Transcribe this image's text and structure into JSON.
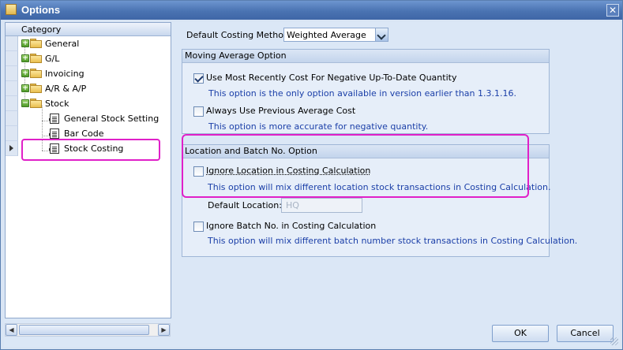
{
  "window": {
    "title": "Options",
    "close_glyph": "✕"
  },
  "category_panel": {
    "header": "Category",
    "items": [
      {
        "label": "General",
        "type": "folder",
        "expander": "+"
      },
      {
        "label": "G/L",
        "type": "folder",
        "expander": "+"
      },
      {
        "label": "Invoicing",
        "type": "folder",
        "expander": "+"
      },
      {
        "label": "A/R & A/P",
        "type": "folder",
        "expander": "+"
      },
      {
        "label": "Stock",
        "type": "folder",
        "expander": "−"
      },
      {
        "label": "General Stock Setting",
        "type": "page"
      },
      {
        "label": "Bar Code",
        "type": "page"
      },
      {
        "label": "Stock Costing",
        "type": "page",
        "selected": true
      }
    ],
    "scroll_left": "◀",
    "scroll_right": "▶"
  },
  "costing": {
    "label": "Default Costing Method:",
    "value": "Weighted Average"
  },
  "moving_average": {
    "title": "Moving Average Option",
    "options": [
      {
        "label": "Use Most Recently Cost For Negative Up-To-Date Quantity",
        "checked": true,
        "note": "This option is the only option available in version earlier than 1.3.1.16."
      },
      {
        "label": "Always Use Previous Average Cost",
        "checked": false,
        "note": "This option is more accurate for negative quantity."
      }
    ]
  },
  "location_batch": {
    "title": "Location and Batch No. Option",
    "ignore_location": {
      "label": "Ignore Location in Costing Calculation",
      "checked": false,
      "note": "This option will mix different location stock transactions in Costing Calculation."
    },
    "default_location": {
      "label": "Default Location:",
      "value": "HQ"
    },
    "ignore_batch": {
      "label": "Ignore Batch No. in Costing Calculation",
      "checked": false,
      "note": "This option will mix different batch number stock transactions in Costing Calculation."
    }
  },
  "buttons": {
    "ok": "OK",
    "cancel": "Cancel"
  },
  "colors": {
    "highlight": "#e020c8",
    "note_text": "#1b3fa8",
    "title_bar": "#4a73b2"
  }
}
